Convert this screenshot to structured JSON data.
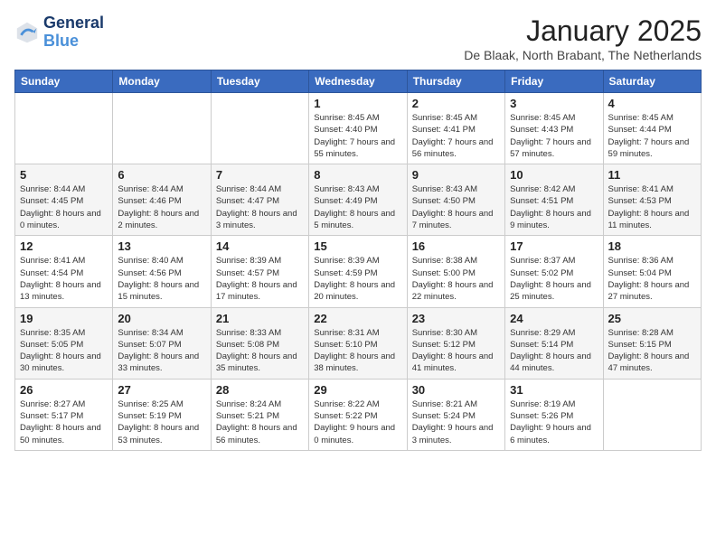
{
  "logo": {
    "line1": "General",
    "line2": "Blue"
  },
  "title": "January 2025",
  "location": "De Blaak, North Brabant, The Netherlands",
  "weekdays": [
    "Sunday",
    "Monday",
    "Tuesday",
    "Wednesday",
    "Thursday",
    "Friday",
    "Saturday"
  ],
  "weeks": [
    [
      {
        "day": "",
        "sunrise": "",
        "sunset": "",
        "daylight": ""
      },
      {
        "day": "",
        "sunrise": "",
        "sunset": "",
        "daylight": ""
      },
      {
        "day": "",
        "sunrise": "",
        "sunset": "",
        "daylight": ""
      },
      {
        "day": "1",
        "sunrise": "Sunrise: 8:45 AM",
        "sunset": "Sunset: 4:40 PM",
        "daylight": "Daylight: 7 hours and 55 minutes."
      },
      {
        "day": "2",
        "sunrise": "Sunrise: 8:45 AM",
        "sunset": "Sunset: 4:41 PM",
        "daylight": "Daylight: 7 hours and 56 minutes."
      },
      {
        "day": "3",
        "sunrise": "Sunrise: 8:45 AM",
        "sunset": "Sunset: 4:43 PM",
        "daylight": "Daylight: 7 hours and 57 minutes."
      },
      {
        "day": "4",
        "sunrise": "Sunrise: 8:45 AM",
        "sunset": "Sunset: 4:44 PM",
        "daylight": "Daylight: 7 hours and 59 minutes."
      }
    ],
    [
      {
        "day": "5",
        "sunrise": "Sunrise: 8:44 AM",
        "sunset": "Sunset: 4:45 PM",
        "daylight": "Daylight: 8 hours and 0 minutes."
      },
      {
        "day": "6",
        "sunrise": "Sunrise: 8:44 AM",
        "sunset": "Sunset: 4:46 PM",
        "daylight": "Daylight: 8 hours and 2 minutes."
      },
      {
        "day": "7",
        "sunrise": "Sunrise: 8:44 AM",
        "sunset": "Sunset: 4:47 PM",
        "daylight": "Daylight: 8 hours and 3 minutes."
      },
      {
        "day": "8",
        "sunrise": "Sunrise: 8:43 AM",
        "sunset": "Sunset: 4:49 PM",
        "daylight": "Daylight: 8 hours and 5 minutes."
      },
      {
        "day": "9",
        "sunrise": "Sunrise: 8:43 AM",
        "sunset": "Sunset: 4:50 PM",
        "daylight": "Daylight: 8 hours and 7 minutes."
      },
      {
        "day": "10",
        "sunrise": "Sunrise: 8:42 AM",
        "sunset": "Sunset: 4:51 PM",
        "daylight": "Daylight: 8 hours and 9 minutes."
      },
      {
        "day": "11",
        "sunrise": "Sunrise: 8:41 AM",
        "sunset": "Sunset: 4:53 PM",
        "daylight": "Daylight: 8 hours and 11 minutes."
      }
    ],
    [
      {
        "day": "12",
        "sunrise": "Sunrise: 8:41 AM",
        "sunset": "Sunset: 4:54 PM",
        "daylight": "Daylight: 8 hours and 13 minutes."
      },
      {
        "day": "13",
        "sunrise": "Sunrise: 8:40 AM",
        "sunset": "Sunset: 4:56 PM",
        "daylight": "Daylight: 8 hours and 15 minutes."
      },
      {
        "day": "14",
        "sunrise": "Sunrise: 8:39 AM",
        "sunset": "Sunset: 4:57 PM",
        "daylight": "Daylight: 8 hours and 17 minutes."
      },
      {
        "day": "15",
        "sunrise": "Sunrise: 8:39 AM",
        "sunset": "Sunset: 4:59 PM",
        "daylight": "Daylight: 8 hours and 20 minutes."
      },
      {
        "day": "16",
        "sunrise": "Sunrise: 8:38 AM",
        "sunset": "Sunset: 5:00 PM",
        "daylight": "Daylight: 8 hours and 22 minutes."
      },
      {
        "day": "17",
        "sunrise": "Sunrise: 8:37 AM",
        "sunset": "Sunset: 5:02 PM",
        "daylight": "Daylight: 8 hours and 25 minutes."
      },
      {
        "day": "18",
        "sunrise": "Sunrise: 8:36 AM",
        "sunset": "Sunset: 5:04 PM",
        "daylight": "Daylight: 8 hours and 27 minutes."
      }
    ],
    [
      {
        "day": "19",
        "sunrise": "Sunrise: 8:35 AM",
        "sunset": "Sunset: 5:05 PM",
        "daylight": "Daylight: 8 hours and 30 minutes."
      },
      {
        "day": "20",
        "sunrise": "Sunrise: 8:34 AM",
        "sunset": "Sunset: 5:07 PM",
        "daylight": "Daylight: 8 hours and 33 minutes."
      },
      {
        "day": "21",
        "sunrise": "Sunrise: 8:33 AM",
        "sunset": "Sunset: 5:08 PM",
        "daylight": "Daylight: 8 hours and 35 minutes."
      },
      {
        "day": "22",
        "sunrise": "Sunrise: 8:31 AM",
        "sunset": "Sunset: 5:10 PM",
        "daylight": "Daylight: 8 hours and 38 minutes."
      },
      {
        "day": "23",
        "sunrise": "Sunrise: 8:30 AM",
        "sunset": "Sunset: 5:12 PM",
        "daylight": "Daylight: 8 hours and 41 minutes."
      },
      {
        "day": "24",
        "sunrise": "Sunrise: 8:29 AM",
        "sunset": "Sunset: 5:14 PM",
        "daylight": "Daylight: 8 hours and 44 minutes."
      },
      {
        "day": "25",
        "sunrise": "Sunrise: 8:28 AM",
        "sunset": "Sunset: 5:15 PM",
        "daylight": "Daylight: 8 hours and 47 minutes."
      }
    ],
    [
      {
        "day": "26",
        "sunrise": "Sunrise: 8:27 AM",
        "sunset": "Sunset: 5:17 PM",
        "daylight": "Daylight: 8 hours and 50 minutes."
      },
      {
        "day": "27",
        "sunrise": "Sunrise: 8:25 AM",
        "sunset": "Sunset: 5:19 PM",
        "daylight": "Daylight: 8 hours and 53 minutes."
      },
      {
        "day": "28",
        "sunrise": "Sunrise: 8:24 AM",
        "sunset": "Sunset: 5:21 PM",
        "daylight": "Daylight: 8 hours and 56 minutes."
      },
      {
        "day": "29",
        "sunrise": "Sunrise: 8:22 AM",
        "sunset": "Sunset: 5:22 PM",
        "daylight": "Daylight: 9 hours and 0 minutes."
      },
      {
        "day": "30",
        "sunrise": "Sunrise: 8:21 AM",
        "sunset": "Sunset: 5:24 PM",
        "daylight": "Daylight: 9 hours and 3 minutes."
      },
      {
        "day": "31",
        "sunrise": "Sunrise: 8:19 AM",
        "sunset": "Sunset: 5:26 PM",
        "daylight": "Daylight: 9 hours and 6 minutes."
      },
      {
        "day": "",
        "sunrise": "",
        "sunset": "",
        "daylight": ""
      }
    ]
  ]
}
